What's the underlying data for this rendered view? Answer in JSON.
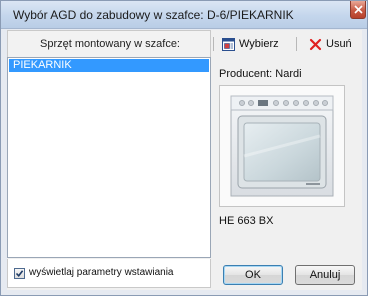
{
  "window": {
    "title": "Wybór AGD do zabudowy w szafce: D-6/PIEKARNIK"
  },
  "left_panel": {
    "header": "Sprzęt montowany w szafce:",
    "items": [
      {
        "label": "PIEKARNIK",
        "selected": true
      }
    ],
    "show_params_checkbox": {
      "label": "wyświetlaj parametry wstawiania",
      "checked": true
    }
  },
  "toolbar": {
    "select_label": "Wybierz",
    "remove_label": "Usuń"
  },
  "details": {
    "producer": "Producent: Nardi",
    "model": "HE 663 BX"
  },
  "buttons": {
    "ok": "OK",
    "cancel": "Anuluj"
  },
  "colors": {
    "selection": "#3399ff",
    "remove_icon": "#e02020",
    "titlebar": "#c4d6ec"
  }
}
